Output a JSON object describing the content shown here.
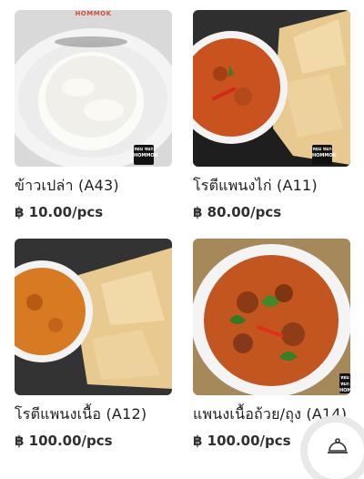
{
  "currency": "฿",
  "products": [
    {
      "name": "ข้าวเปล่า (A43)",
      "price": "10.00/pcs",
      "photo_logo": "HOMMOK",
      "watermark": "หอม หมก HOMMOK"
    },
    {
      "name": "โรตีแพนงไก่ (A11)",
      "price": "80.00/pcs",
      "watermark": "หอม หมก HOMMOK"
    },
    {
      "name": "โรตีแพนงเนื้อ (A12)",
      "price": "100.00/pcs"
    },
    {
      "name": "แพนงเนื้อถ้วย/ถุง (A14)",
      "price": "100.00/pcs",
      "watermark": "หอม หมก HOMMOK"
    }
  ],
  "cart_icon": "cloche-icon",
  "colors": {
    "text": "#202020",
    "price": "#303030",
    "fab_ring": "#e9e9e9",
    "curry": "#c9521f"
  }
}
